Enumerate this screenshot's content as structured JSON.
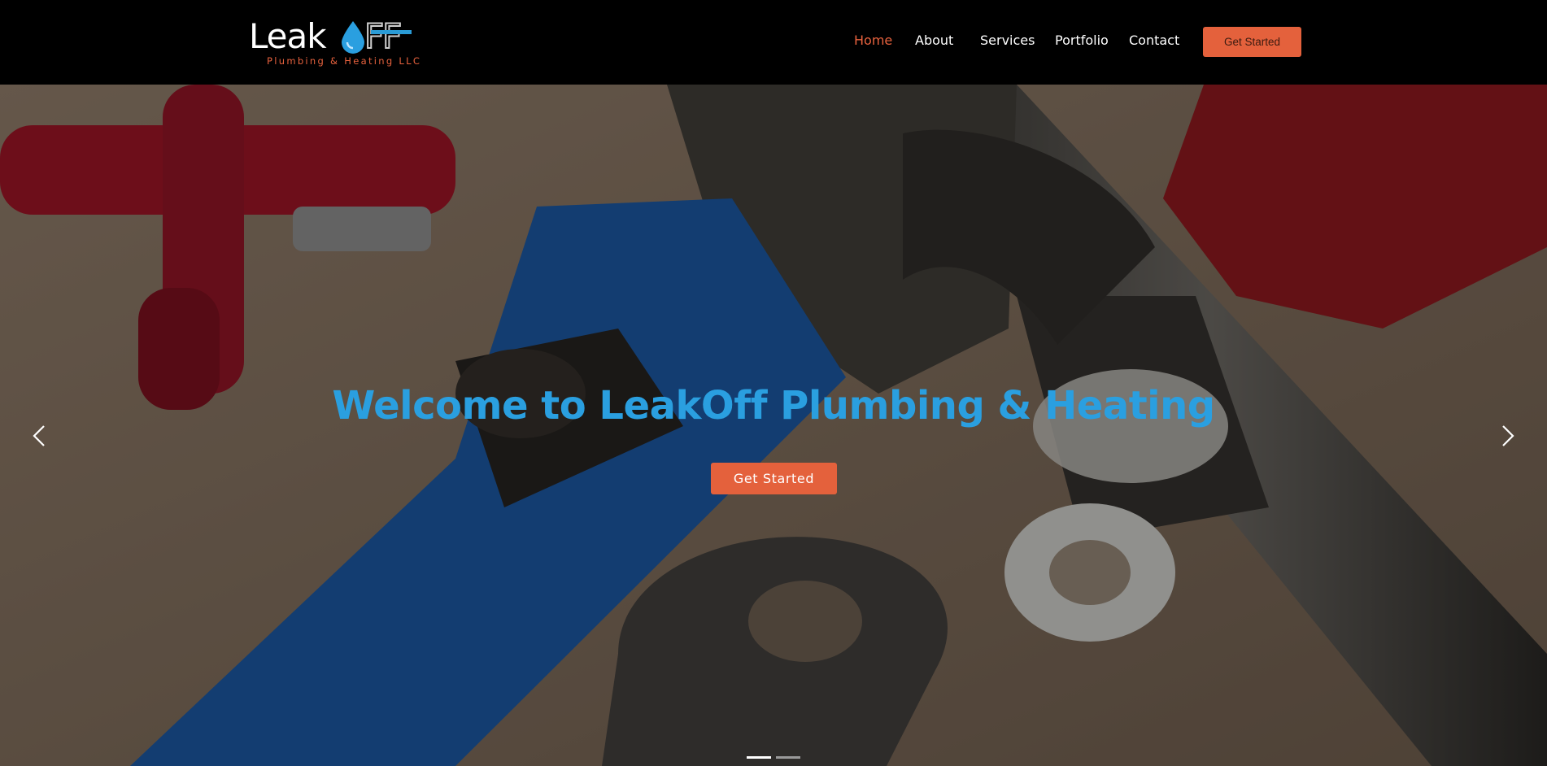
{
  "brand": {
    "word": "Leak",
    "word_suffix": "FF",
    "tagline": "Plumbing & Heating LLC",
    "accent_color": "#e4613c",
    "blue_color": "#2a9fe0"
  },
  "nav": {
    "items": [
      {
        "label": "Home",
        "active": true
      },
      {
        "label": "About",
        "active": false
      },
      {
        "label": "Services",
        "active": false
      },
      {
        "label": "Portfolio",
        "active": false
      },
      {
        "label": "Contact",
        "active": false
      }
    ],
    "cta_label": "Get Started"
  },
  "hero": {
    "title": "Welcome to LeakOff Plumbing & Heating",
    "cta_label": "Get Started",
    "prev_icon": "chevron-left-icon",
    "next_icon": "chevron-right-icon",
    "slide_count": 2,
    "active_slide": 1
  }
}
